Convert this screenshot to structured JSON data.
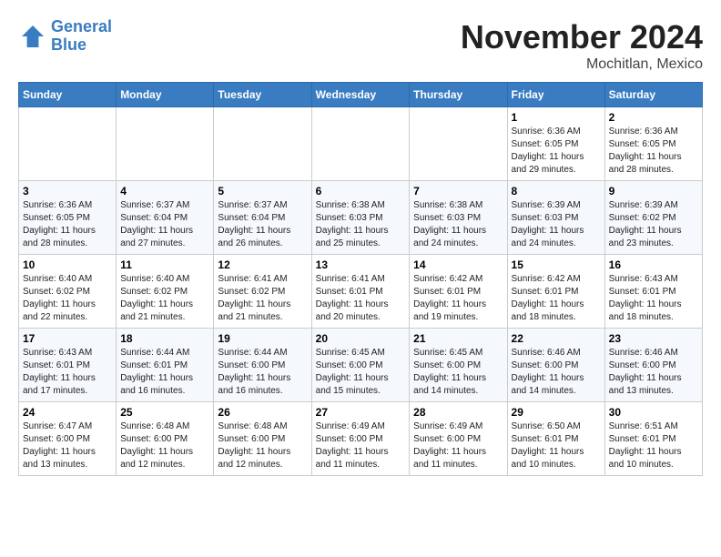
{
  "header": {
    "logo_line1": "General",
    "logo_line2": "Blue",
    "month_title": "November 2024",
    "location": "Mochitlan, Mexico"
  },
  "weekdays": [
    "Sunday",
    "Monday",
    "Tuesday",
    "Wednesday",
    "Thursday",
    "Friday",
    "Saturday"
  ],
  "weeks": [
    [
      {
        "day": "",
        "info": ""
      },
      {
        "day": "",
        "info": ""
      },
      {
        "day": "",
        "info": ""
      },
      {
        "day": "",
        "info": ""
      },
      {
        "day": "",
        "info": ""
      },
      {
        "day": "1",
        "info": "Sunrise: 6:36 AM\nSunset: 6:05 PM\nDaylight: 11 hours and 29 minutes."
      },
      {
        "day": "2",
        "info": "Sunrise: 6:36 AM\nSunset: 6:05 PM\nDaylight: 11 hours and 28 minutes."
      }
    ],
    [
      {
        "day": "3",
        "info": "Sunrise: 6:36 AM\nSunset: 6:05 PM\nDaylight: 11 hours and 28 minutes."
      },
      {
        "day": "4",
        "info": "Sunrise: 6:37 AM\nSunset: 6:04 PM\nDaylight: 11 hours and 27 minutes."
      },
      {
        "day": "5",
        "info": "Sunrise: 6:37 AM\nSunset: 6:04 PM\nDaylight: 11 hours and 26 minutes."
      },
      {
        "day": "6",
        "info": "Sunrise: 6:38 AM\nSunset: 6:03 PM\nDaylight: 11 hours and 25 minutes."
      },
      {
        "day": "7",
        "info": "Sunrise: 6:38 AM\nSunset: 6:03 PM\nDaylight: 11 hours and 24 minutes."
      },
      {
        "day": "8",
        "info": "Sunrise: 6:39 AM\nSunset: 6:03 PM\nDaylight: 11 hours and 24 minutes."
      },
      {
        "day": "9",
        "info": "Sunrise: 6:39 AM\nSunset: 6:02 PM\nDaylight: 11 hours and 23 minutes."
      }
    ],
    [
      {
        "day": "10",
        "info": "Sunrise: 6:40 AM\nSunset: 6:02 PM\nDaylight: 11 hours and 22 minutes."
      },
      {
        "day": "11",
        "info": "Sunrise: 6:40 AM\nSunset: 6:02 PM\nDaylight: 11 hours and 21 minutes."
      },
      {
        "day": "12",
        "info": "Sunrise: 6:41 AM\nSunset: 6:02 PM\nDaylight: 11 hours and 21 minutes."
      },
      {
        "day": "13",
        "info": "Sunrise: 6:41 AM\nSunset: 6:01 PM\nDaylight: 11 hours and 20 minutes."
      },
      {
        "day": "14",
        "info": "Sunrise: 6:42 AM\nSunset: 6:01 PM\nDaylight: 11 hours and 19 minutes."
      },
      {
        "day": "15",
        "info": "Sunrise: 6:42 AM\nSunset: 6:01 PM\nDaylight: 11 hours and 18 minutes."
      },
      {
        "day": "16",
        "info": "Sunrise: 6:43 AM\nSunset: 6:01 PM\nDaylight: 11 hours and 18 minutes."
      }
    ],
    [
      {
        "day": "17",
        "info": "Sunrise: 6:43 AM\nSunset: 6:01 PM\nDaylight: 11 hours and 17 minutes."
      },
      {
        "day": "18",
        "info": "Sunrise: 6:44 AM\nSunset: 6:01 PM\nDaylight: 11 hours and 16 minutes."
      },
      {
        "day": "19",
        "info": "Sunrise: 6:44 AM\nSunset: 6:00 PM\nDaylight: 11 hours and 16 minutes."
      },
      {
        "day": "20",
        "info": "Sunrise: 6:45 AM\nSunset: 6:00 PM\nDaylight: 11 hours and 15 minutes."
      },
      {
        "day": "21",
        "info": "Sunrise: 6:45 AM\nSunset: 6:00 PM\nDaylight: 11 hours and 14 minutes."
      },
      {
        "day": "22",
        "info": "Sunrise: 6:46 AM\nSunset: 6:00 PM\nDaylight: 11 hours and 14 minutes."
      },
      {
        "day": "23",
        "info": "Sunrise: 6:46 AM\nSunset: 6:00 PM\nDaylight: 11 hours and 13 minutes."
      }
    ],
    [
      {
        "day": "24",
        "info": "Sunrise: 6:47 AM\nSunset: 6:00 PM\nDaylight: 11 hours and 13 minutes."
      },
      {
        "day": "25",
        "info": "Sunrise: 6:48 AM\nSunset: 6:00 PM\nDaylight: 11 hours and 12 minutes."
      },
      {
        "day": "26",
        "info": "Sunrise: 6:48 AM\nSunset: 6:00 PM\nDaylight: 11 hours and 12 minutes."
      },
      {
        "day": "27",
        "info": "Sunrise: 6:49 AM\nSunset: 6:00 PM\nDaylight: 11 hours and 11 minutes."
      },
      {
        "day": "28",
        "info": "Sunrise: 6:49 AM\nSunset: 6:00 PM\nDaylight: 11 hours and 11 minutes."
      },
      {
        "day": "29",
        "info": "Sunrise: 6:50 AM\nSunset: 6:01 PM\nDaylight: 11 hours and 10 minutes."
      },
      {
        "day": "30",
        "info": "Sunrise: 6:51 AM\nSunset: 6:01 PM\nDaylight: 11 hours and 10 minutes."
      }
    ]
  ]
}
